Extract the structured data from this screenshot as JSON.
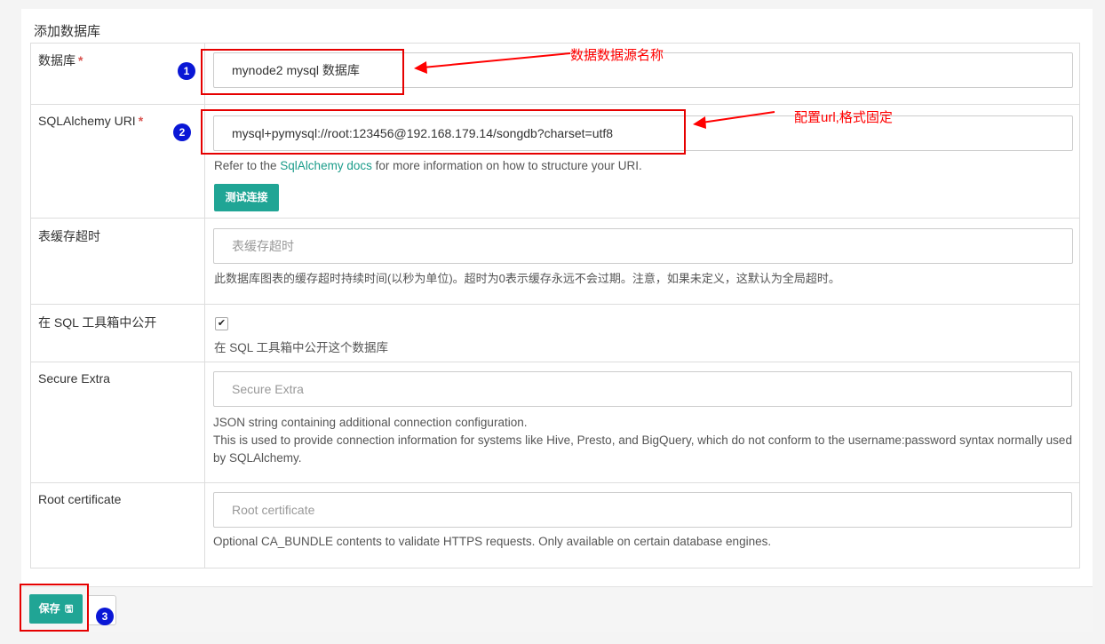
{
  "page": {
    "title": "添加数据库"
  },
  "fields": {
    "database": {
      "label": "数据库",
      "required_mark": "*",
      "value": "mynode2 mysql 数据库"
    },
    "sqlalchemy_uri": {
      "label": "SQLAlchemy URI",
      "required_mark": "*",
      "value": "mysql+pymysql://root:123456@192.168.179.14/songdb?charset=utf8",
      "help_prefix": "Refer to the ",
      "help_link": "SqlAlchemy docs",
      "help_suffix": " for more information on how to structure your URI.",
      "test_button": "测试连接"
    },
    "cache_timeout": {
      "label": "表缓存超时",
      "placeholder": "表缓存超时",
      "help": "此数据库图表的缓存超时持续时间(以秒为单位)。超时为0表示缓存永远不会过期。注意，如果未定义，这默认为全局超时。"
    },
    "expose_in_sqllab": {
      "label": "在 SQL 工具箱中公开",
      "checked": true,
      "check_glyph": "✔",
      "help": "在 SQL 工具箱中公开这个数据库"
    },
    "secure_extra": {
      "label": "Secure Extra",
      "placeholder": "Secure Extra",
      "help_line1": "JSON string containing additional connection configuration.",
      "help_line2": "This is used to provide connection information for systems like Hive, Presto, and BigQuery, which do not conform to the username:password syntax normally used by SQLAlchemy."
    },
    "root_certificate": {
      "label": "Root certificate",
      "placeholder": "Root certificate",
      "help": "Optional CA_BUNDLE contents to validate HTTPS requests. Only available on certain database engines."
    }
  },
  "footer": {
    "save_label": "保存",
    "save_icon": "floppy-disk-icon",
    "save_icon_glyph": "🖫",
    "back_glyph": "‹"
  },
  "annotations": {
    "step1": "1",
    "step2": "2",
    "step3": "3",
    "note1": "数据数据源名称",
    "note2": "配置url,格式固定",
    "color": "#ff0000",
    "circle_color": "#0a17d6"
  },
  "colors": {
    "accent": "#20a595",
    "required": "#d9534f",
    "link": "#1a9c8a"
  }
}
